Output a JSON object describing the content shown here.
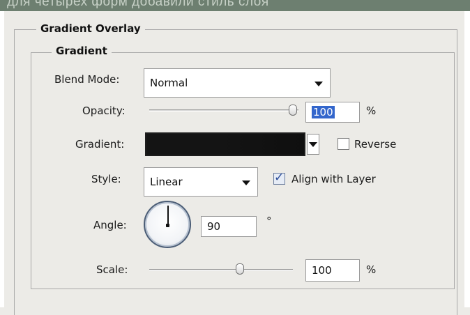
{
  "window": {
    "banner_text": "для четырех форм добавили стиль слоя"
  },
  "panel": {
    "section_title": "Gradient Overlay",
    "group_title": "Gradient"
  },
  "blend_mode": {
    "label": "Blend Mode:",
    "value": "Normal"
  },
  "opacity": {
    "label": "Opacity:",
    "value": "100",
    "unit": "%",
    "slider_fraction": 1.0
  },
  "gradient": {
    "label": "Gradient:",
    "colors": [
      "#141414",
      "#0f0f0f"
    ]
  },
  "reverse": {
    "label": "Reverse",
    "checked": false
  },
  "style": {
    "label": "Style:",
    "value": "Linear"
  },
  "align_with_layer": {
    "label": "Align with Layer",
    "checked": true
  },
  "angle": {
    "label": "Angle:",
    "value": "90",
    "unit": "°"
  },
  "scale": {
    "label": "Scale:",
    "value": "100",
    "unit": "%",
    "slider_fraction": 0.6
  }
}
